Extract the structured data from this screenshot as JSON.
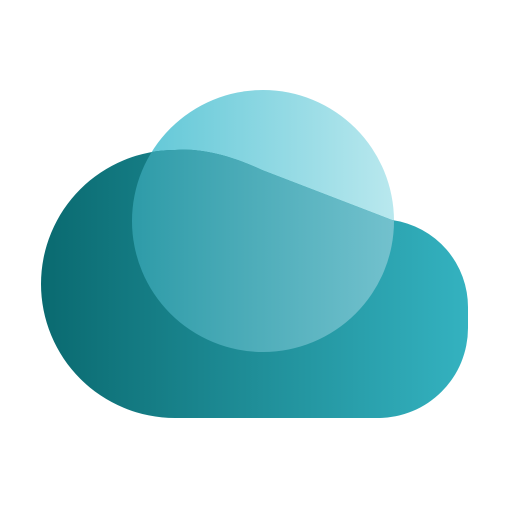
{
  "icon": {
    "name": "cloud-icon",
    "colors": {
      "cloud_dark": "#0a6a70",
      "cloud_light": "#34b2c0",
      "sun_light": "#b9e8ee",
      "sun_mid": "#5ec6d6",
      "overlap_dark": "#168e9b",
      "overlap_light": "#86ccd8",
      "background": "#ffffff"
    }
  }
}
